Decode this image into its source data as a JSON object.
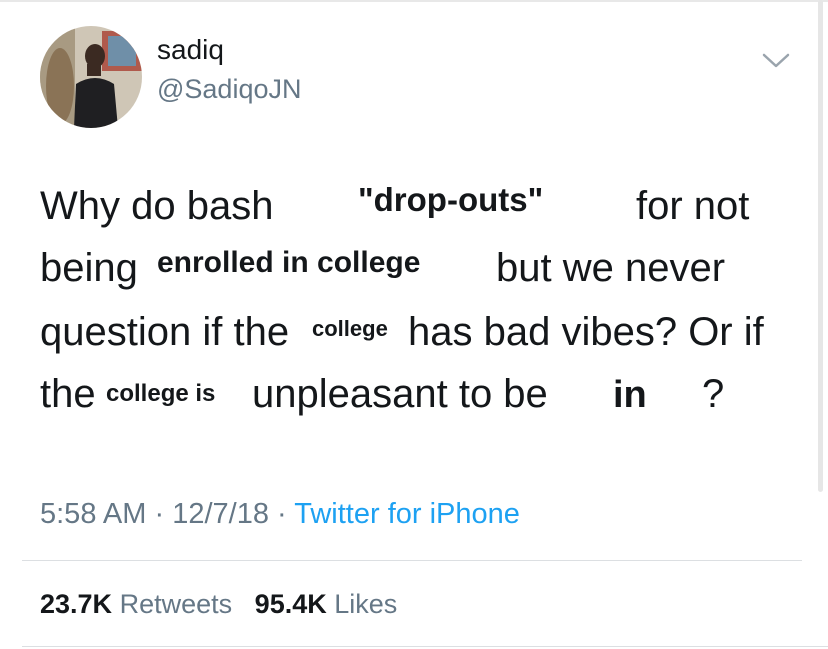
{
  "tweet": {
    "display_name": "sadiq",
    "handle": "@SadiqoJN",
    "body": {
      "line1": {
        "a": "Why do bash",
        "b": "\"drop-outs\"",
        "c": "for not"
      },
      "line2": {
        "a": "being",
        "b": "enrolled in college",
        "c": "but we never"
      },
      "line3": {
        "a": "question if the",
        "b": "college",
        "c": "has bad vibes? Or if"
      },
      "line4": {
        "a": "the",
        "b": "college is",
        "c": "unpleasant to be",
        "d": "in",
        "e": "?"
      }
    },
    "time": "5:58 AM",
    "date": "12/7/18",
    "source": "Twitter for iPhone",
    "separator": "·",
    "retweets_count": "23.7K",
    "retweets_label": "Retweets",
    "likes_count": "95.4K",
    "likes_label": "Likes"
  },
  "colors": {
    "text": "#14171a",
    "secondary": "#657786",
    "link": "#1da1f2",
    "divider": "#dcdfe2"
  },
  "icons": {
    "more": "chevron-down-icon",
    "avatar": "avatar"
  }
}
